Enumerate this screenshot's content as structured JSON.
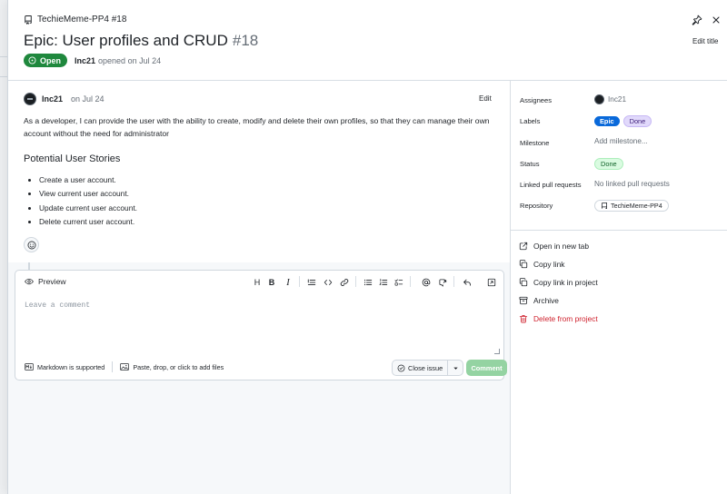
{
  "header": {
    "repo_ref": "TechieMeme-PP4 #18",
    "title": "Epic: User profiles and CRUD",
    "number": "#18",
    "state": "Open",
    "author": "Inc21",
    "opened_text": "opened on Jul 24",
    "edit_title": "Edit title"
  },
  "body": {
    "author": "Inc21",
    "date": "on Jul 24",
    "edit": "Edit",
    "description": "As a developer, I can provide the user with the ability to create, modify and delete their own profiles, so that they can manage their own account without the need for administrator",
    "heading": "Potential User Stories",
    "stories": [
      "Create a user account.",
      "View current user account.",
      "Update current user account.",
      "Delete current user account."
    ]
  },
  "comment": {
    "preview": "Preview",
    "placeholder": "Leave a comment",
    "markdown_note": "Markdown is supported",
    "attach_note": "Paste, drop, or click to add files",
    "close_issue": "Close issue",
    "comment_btn": "Comment",
    "toolbar": {
      "heading": "H",
      "bold": "B",
      "italic": "I"
    }
  },
  "sidebar": {
    "assignees_label": "Assignees",
    "assignee": "Inc21",
    "labels_label": "Labels",
    "labels": [
      "Epic",
      "Done"
    ],
    "milestone_label": "Milestone",
    "milestone_value": "Add milestone...",
    "status_label": "Status",
    "status_value": "Done",
    "linked_label": "Linked pull requests",
    "linked_value": "No linked pull requests",
    "repo_label": "Repository",
    "repo_value": "TechieMeme-PP4",
    "actions": [
      "Open in new tab",
      "Copy link",
      "Copy link in project",
      "Archive",
      "Delete from project"
    ]
  },
  "colors": {
    "open_green": "#1f883d",
    "epic_blue": "#0969da",
    "danger_red": "#cf222e",
    "comment_disabled": "#94d3a2"
  }
}
